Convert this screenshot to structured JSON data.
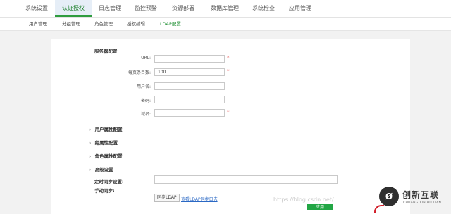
{
  "top_nav": {
    "tabs": [
      {
        "label": "系统设置"
      },
      {
        "label": "认证授权"
      },
      {
        "label": "日志管理"
      },
      {
        "label": "监控预警"
      },
      {
        "label": "资源部署"
      },
      {
        "label": "数据库管理"
      },
      {
        "label": "系统检查"
      },
      {
        "label": "应用管理"
      }
    ],
    "active_color": "#2e9c3e"
  },
  "sub_nav": {
    "tabs": [
      {
        "label": "用户管理"
      },
      {
        "label": "分组管理"
      },
      {
        "label": "角色管理"
      },
      {
        "label": "授权编辑"
      },
      {
        "label": "LDAP配置"
      }
    ],
    "active_color": "#1b8d2f"
  },
  "server_config": {
    "title": "服务器配置",
    "fields": [
      {
        "label": "URL:",
        "value": "",
        "required": true
      },
      {
        "label": "每页条目数:",
        "value": "100",
        "required": true
      },
      {
        "label": "用户名:",
        "value": "",
        "required": false
      },
      {
        "label": "密码:",
        "value": "",
        "required": false
      },
      {
        "label": "域名:",
        "value": "",
        "required": true
      }
    ],
    "required_mark": "*"
  },
  "collapsible_sections": [
    {
      "label": "用户属性配置",
      "icon": "chevron-right-icon"
    },
    {
      "label": "组属性配置",
      "icon": "chevron-right-icon"
    },
    {
      "label": "角色属性配置",
      "icon": "chevron-right-icon"
    },
    {
      "label": "高级设置",
      "icon": "chevron-right-icon"
    }
  ],
  "sync": {
    "scheduled_label": "定时同步设置:",
    "scheduled_value": "",
    "manual_label": "手动同步:",
    "sync_button": "同步LDAP",
    "log_link": "查看LDAP同步日志"
  },
  "apply_button": "应用",
  "watermark": "https://blog.csdn.net/...",
  "brand": {
    "name_cn": "创新互联",
    "name_en": "CHUANG XIN HU LIAN",
    "logo_glyph": "Ø"
  }
}
